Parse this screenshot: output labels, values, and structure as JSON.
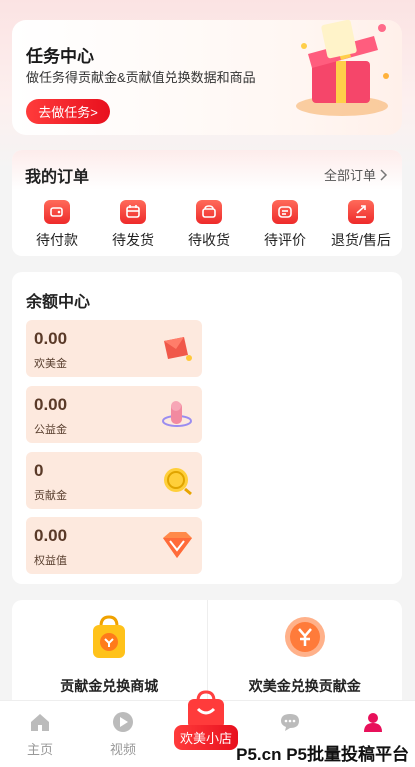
{
  "task_center": {
    "title": "任务中心",
    "subtitle": "做任务得贡献金&贡献值兑换数据和商品",
    "button": "去做任务>"
  },
  "orders": {
    "title": "我的订单",
    "all_label": "全部订单",
    "items": [
      {
        "label": "待付款",
        "icon": "wallet-icon"
      },
      {
        "label": "待发货",
        "icon": "calendar-box-icon"
      },
      {
        "label": "待收货",
        "icon": "bag-icon"
      },
      {
        "label": "待评价",
        "icon": "comment-icon"
      },
      {
        "label": "退货/售后",
        "icon": "return-icon"
      }
    ]
  },
  "balance": {
    "title": "余额中心",
    "items": [
      {
        "value": "0.00",
        "label": "欢美金",
        "icon": "red-envelope-icon"
      },
      {
        "value": "0.00",
        "label": "公益金",
        "icon": "hand-globe-icon"
      },
      {
        "value": "0",
        "label": "贡献金",
        "icon": "coin-icon"
      },
      {
        "value": "0.00",
        "label": "权益值",
        "icon": "diamond-icon"
      }
    ]
  },
  "exchange": {
    "items": [
      {
        "label": "贡献金兑换商城",
        "icon": "exchange-bag-icon"
      },
      {
        "label": "欢美金兑换贡献金",
        "icon": "yuan-coin-icon"
      }
    ]
  },
  "tabbar": {
    "home": "主页",
    "video": "视频",
    "shop": "欢美小店",
    "message": "",
    "mine": ""
  },
  "watermark": "P5.cn P5批量投稿平台",
  "colors": {
    "accent": "#e8101e",
    "balance_bg": "#fde9de",
    "balance_text": "#5a3a28"
  }
}
